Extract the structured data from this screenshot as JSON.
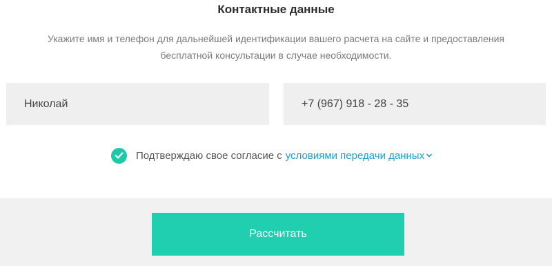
{
  "form": {
    "title": "Контактные данные",
    "description_line1": "Укажите имя и телефон для дальнейшей идентификации вашего расчета на сайте и предоставления",
    "description_line2": "бесплатной консультации в случае необходимости.",
    "name_value": "Николай",
    "phone_value": "+7 (967) 918 - 28 - 35",
    "consent_text": "Подтверждаю свое согласие с",
    "consent_link": "условиями передачи данных",
    "consent_checked": true,
    "submit_label": "Рассчитать"
  },
  "icons": {
    "checkbox": "checkmark-icon",
    "link_chevron": "chevron-down-icon"
  },
  "colors": {
    "accent": "#1fcfb0",
    "link": "#1a9fd6",
    "field_bg": "#efefef",
    "footer_bg": "#f1f1f1"
  }
}
